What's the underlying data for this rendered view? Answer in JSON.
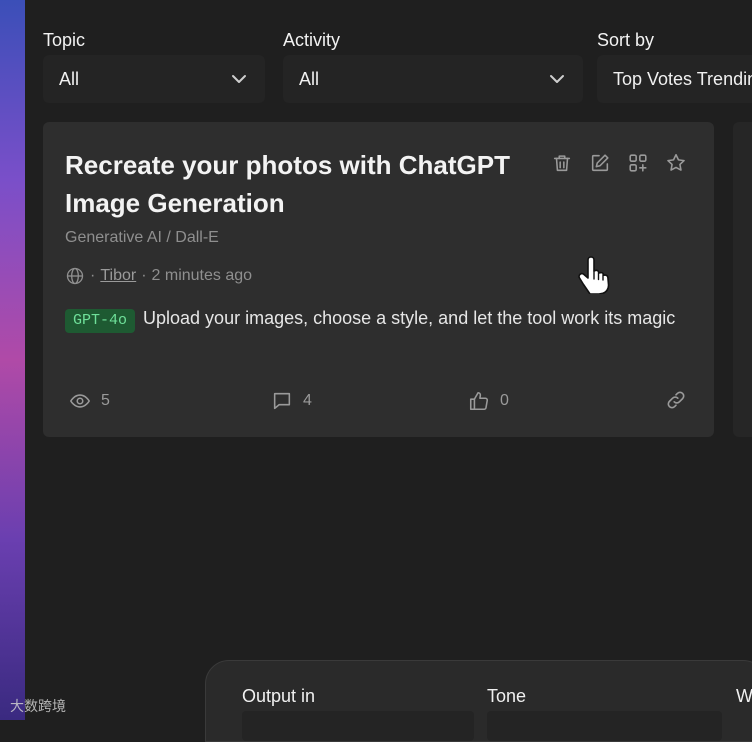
{
  "filters": {
    "topic": {
      "label": "Topic",
      "value": "All"
    },
    "activity": {
      "label": "Activity",
      "value": "All"
    },
    "sort": {
      "label": "Sort by",
      "value": "Top Votes Trending"
    }
  },
  "card": {
    "title": "Recreate your photos with ChatGPT Image Generation",
    "category": "Generative AI / Dall-E",
    "author": "Tibor",
    "time": "2 minutes ago",
    "separator": "·",
    "tag": "GPT-4o",
    "description": "Upload your images, choose a style, and let the tool work its magic",
    "views": "5",
    "comments": "4",
    "likes": "0",
    "action_icons": [
      "trash-icon",
      "edit-icon",
      "add-apps-icon",
      "star-icon"
    ]
  },
  "bottom_panel": {
    "output_label": "Output in",
    "tone_label": "Tone",
    "third_label": "W"
  },
  "watermark": "大数跨境"
}
